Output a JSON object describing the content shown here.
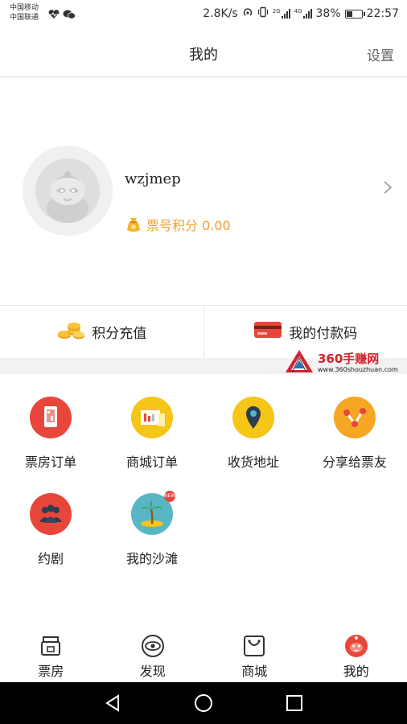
{
  "status_bar": {
    "carrier_1": "中国移动",
    "carrier_2": "中国联通",
    "speed": "2.8K/s",
    "net_2g": "2G",
    "net_4g": "4G",
    "battery": "38%",
    "battery_level": 0.38,
    "time": "22:57"
  },
  "header": {
    "title": "我的",
    "settings_label": "设置"
  },
  "profile": {
    "username": "wzjmep",
    "points_label": "票号积分 0.00"
  },
  "actions": [
    {
      "label": "积分充值",
      "icon": "gold-coins-icon"
    },
    {
      "label": "我的付款码",
      "icon": "payment-card-icon"
    }
  ],
  "watermark": {
    "title": "360手赚网",
    "url": "www.360shouzhuan.com"
  },
  "grid": [
    {
      "label": "票房订单",
      "icon": "ticket-order-icon",
      "color": "#e8463b"
    },
    {
      "label": "商城订单",
      "icon": "mall-order-icon",
      "color": "#f5c518"
    },
    {
      "label": "收货地址",
      "icon": "location-pin-icon",
      "color": "#f5c518"
    },
    {
      "label": "分享给票友",
      "icon": "share-icon",
      "color": "#f5a623"
    },
    {
      "label": "约剧",
      "icon": "group-people-icon",
      "color": "#e8463b"
    },
    {
      "label": "我的沙滩",
      "icon": "beach-palm-icon",
      "color": "#58b6c5",
      "badge": "NEW"
    }
  ],
  "tabs": [
    {
      "label": "票房",
      "icon": "box-office-icon",
      "active": false
    },
    {
      "label": "发现",
      "icon": "eye-icon",
      "active": false
    },
    {
      "label": "商城",
      "icon": "shop-bag-icon",
      "active": false
    },
    {
      "label": "我的",
      "icon": "mascot-icon",
      "active": true,
      "active_color": "#e8463b"
    }
  ],
  "nav": {
    "back": "back-icon",
    "home": "home-icon",
    "recent": "recent-apps-icon"
  }
}
